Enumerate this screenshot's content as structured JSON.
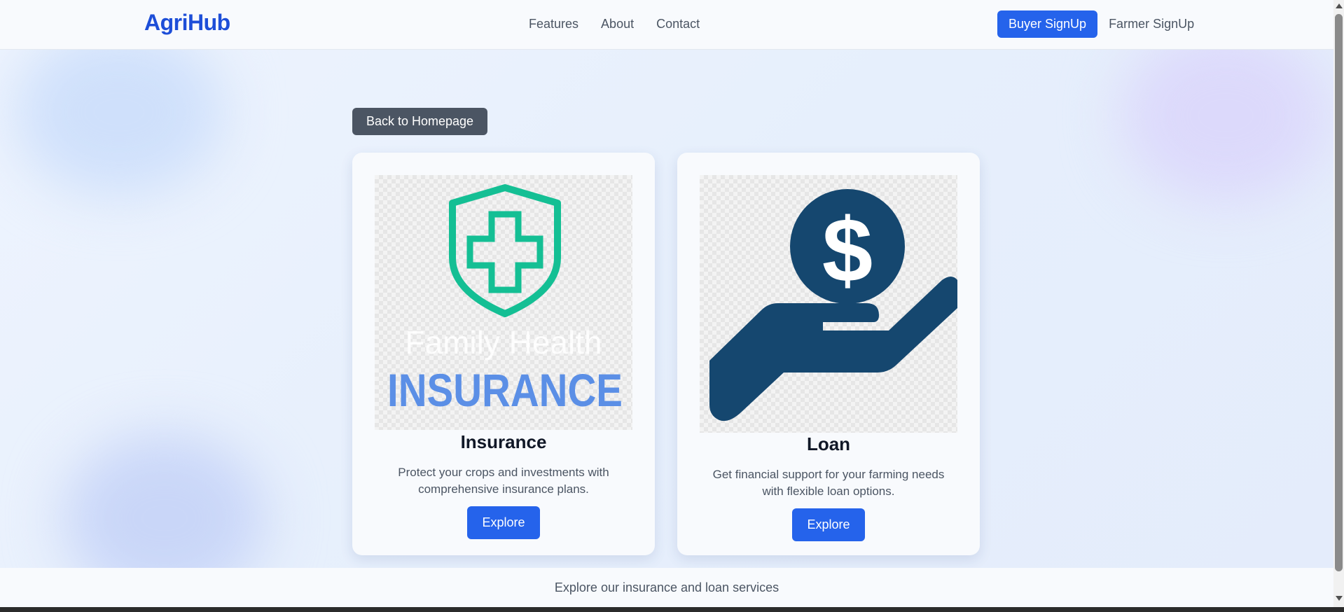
{
  "header": {
    "logo": "AgriHub",
    "nav_links": [
      "Features",
      "About",
      "Contact"
    ],
    "buyer_signup": "Buyer SignUp",
    "farmer_signup": "Farmer SignUp"
  },
  "back_button": "Back to Homepage",
  "cards": [
    {
      "title": "Insurance",
      "description": "Protect your crops and investments with comprehensive insurance plans.",
      "button": "Explore",
      "image": {
        "icon": "shield-plus-icon",
        "caption_faint": "Family Health",
        "caption": "INSURANCE"
      }
    },
    {
      "title": "Loan",
      "description": "Get financial support for your farming needs with flexible loan options.",
      "button": "Explore",
      "image": {
        "icon": "hand-coin-dollar-icon"
      }
    }
  ],
  "footer": {
    "text": "Explore our insurance and loan services"
  },
  "colors": {
    "brand": "#1d4ed8",
    "primary_button": "#2563eb",
    "back_button": "#4b5563",
    "shield_green": "#14bf94",
    "insurance_blue": "#5b8fe6",
    "loan_navy": "#15476f"
  }
}
